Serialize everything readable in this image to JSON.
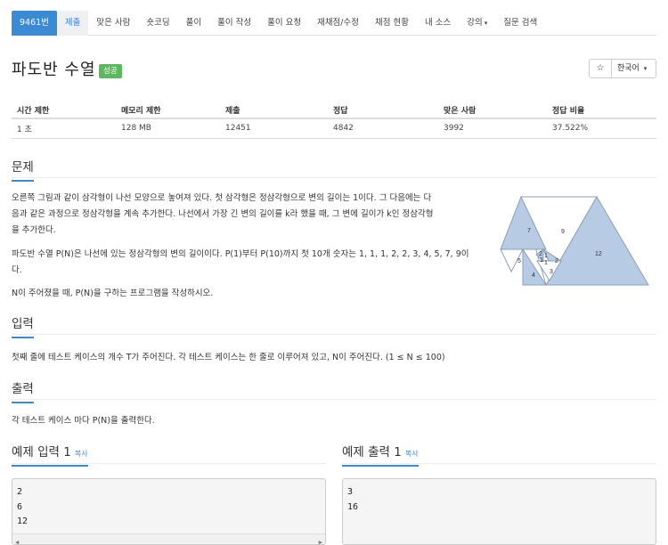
{
  "nav": {
    "items": [
      "9461번",
      "제출",
      "맞은 사람",
      "숏코딩",
      "풀이",
      "풀이 작성",
      "풀이 요청",
      "재채점/수정",
      "채점 현황",
      "내 소스",
      "강의",
      "질문 검색"
    ]
  },
  "problem": {
    "title": "파도반 수열",
    "badge": "성공",
    "lang_button": "한국어",
    "star_icon": "star-outline-icon"
  },
  "info_table": {
    "headers": [
      "시간 제한",
      "메모리 제한",
      "제출",
      "정답",
      "맞은 사람",
      "정답 비율"
    ],
    "values": [
      "1 초",
      "128 MB",
      "12451",
      "4842",
      "3992",
      "37.522%"
    ]
  },
  "sections": {
    "description_title": "문제",
    "description_lines": [
      "오른쪽 그림과 같이 삼각형이 나선 모양으로 놓여져 있다. 첫 삼각형은 정삼각형으로 변의 길이는 1이다. 그 다음에는 다",
      "음과 같은 과정으로 정삼각형을 계속 추가한다. 나선에서 가장 긴 변의 길이를 k라 했을 때, 그 변에 길이가 k인 정삼각형",
      "을 추가한다."
    ],
    "description_p2_lines": [
      "파도반 수열 P(N)은 나선에 있는 정삼각형의 변의 길이이다. P(1)부터 P(10)까지 첫 10개 숫자는 1, 1, 1, 2, 2, 3, 4, 5, 7, 9이",
      "다."
    ],
    "description_p3": "N이 주어졌을 때, P(N)을 구하는 프로그램을 작성하시오.",
    "input_title": "입력",
    "input_text": "첫째 줄에 테스트 케이스의 개수 T가 주어진다. 각 테스트 케이스는 한 줄로 이루어져 있고, N이 주어진다. (1 ≤ N ≤ 100)",
    "output_title": "출력",
    "output_text": "각 테스트 케이스 마다 P(N)을 출력한다."
  },
  "figure": {
    "labels": [
      "7",
      "9",
      "12",
      "5",
      "4",
      "3",
      "2",
      "1",
      "1",
      "1",
      "2"
    ],
    "colors": {
      "shaded": "#b8cbe4",
      "stroke": "#8a9fb8"
    }
  },
  "examples": {
    "input_title": "예제 입력 1",
    "input_copy": "복사",
    "input_lines": [
      "2",
      "6",
      "12"
    ],
    "output_title": "예제 출력 1",
    "output_copy": "복사",
    "output_lines": [
      "3",
      "16"
    ]
  },
  "colors": {
    "accent": "#3a8ad4",
    "success": "#5cb85c"
  }
}
